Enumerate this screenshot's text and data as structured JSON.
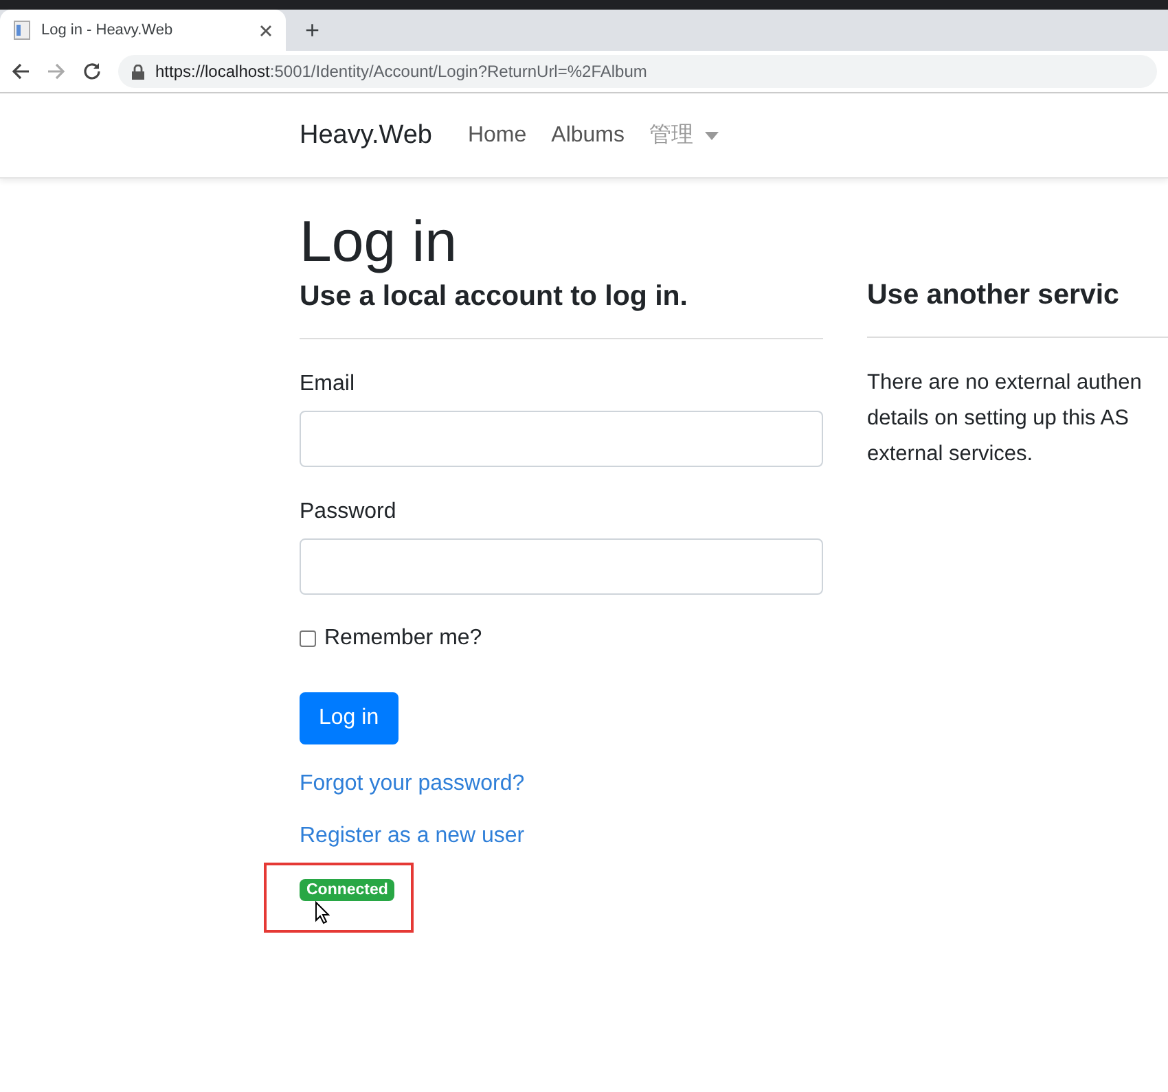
{
  "browser": {
    "tab_title": "Log in - Heavy.Web",
    "new_tab": "+",
    "url_host": "https://localhost",
    "url_rest": ":5001/Identity/Account/Login?ReturnUrl=%2FAlbum"
  },
  "navbar": {
    "brand": "Heavy.Web",
    "links": [
      {
        "label": "Home",
        "kind": "link"
      },
      {
        "label": "Albums",
        "kind": "link"
      },
      {
        "label": "管理",
        "kind": "dropdown"
      }
    ]
  },
  "page": {
    "title": "Log in",
    "local": {
      "heading": "Use a local account to log in.",
      "fields": [
        {
          "label": "Email"
        },
        {
          "label": "Password"
        }
      ],
      "remember": {
        "label": "Remember me?",
        "checked": false
      },
      "submit": "Log in",
      "links": [
        "Forgot your password?",
        "Register as a new user"
      ],
      "status_badge": "Connected"
    },
    "external": {
      "heading": "Use another servic",
      "lines": [
        "There are no external authen",
        "details on setting up this AS",
        "external services."
      ]
    }
  }
}
